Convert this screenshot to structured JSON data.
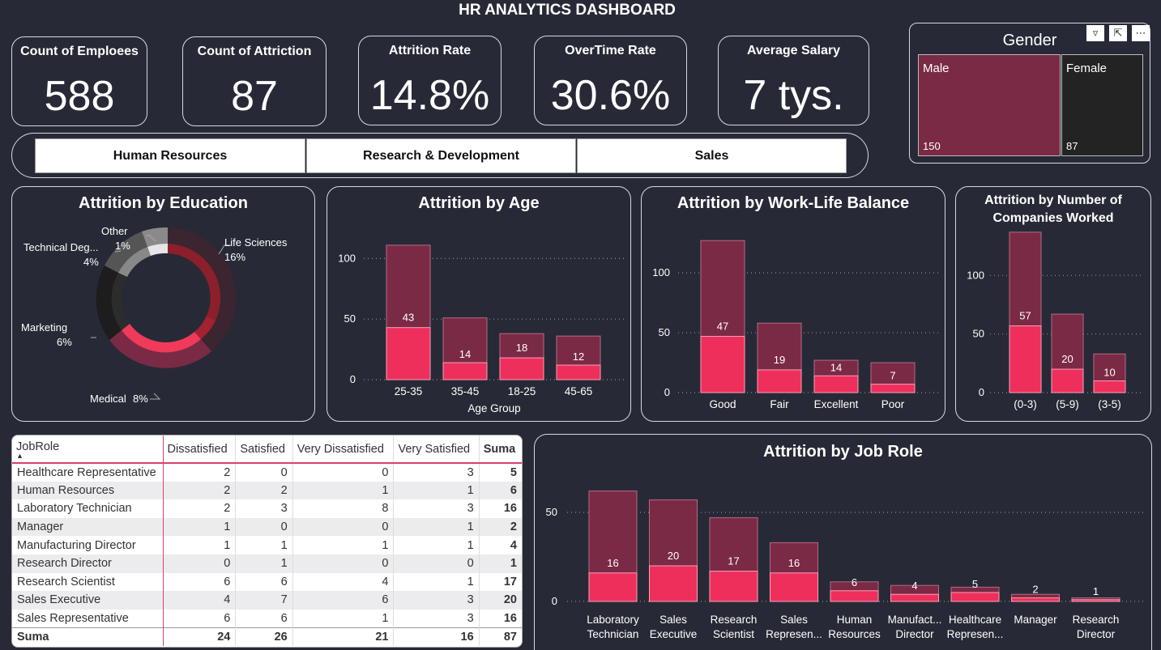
{
  "header": {
    "title": "HR ANALYTICS DASHBOARD"
  },
  "kpis": [
    {
      "label": "Count of Emploees",
      "value": "588"
    },
    {
      "label": "Count of Attriction",
      "value": "87"
    },
    {
      "label": "Attrition Rate",
      "value": "14.8%"
    },
    {
      "label": "OverTime Rate",
      "value": "30.6%"
    },
    {
      "label": "Average Salary",
      "value": "7 tys."
    }
  ],
  "departments": [
    "Human Resources",
    "Research & Development",
    "Sales"
  ],
  "gender": {
    "title": "Gender",
    "items": [
      {
        "label": "Male",
        "value": 150,
        "color": "#7a2a45"
      },
      {
        "label": "Female",
        "value": 87,
        "color": "#232323"
      }
    ]
  },
  "colors": {
    "bar_total": "#7a2a45",
    "bar_attr": "#ee2f5c",
    "accent": "#d7426d"
  },
  "chart_data": [
    {
      "id": "education",
      "type": "pie",
      "title": "Attrition by Education",
      "slices": [
        {
          "label": "Life Sciences",
          "pct": "16%",
          "color": "#8b1f2b"
        },
        {
          "label": "Medical",
          "pct": "8%",
          "color": "#f03a5a"
        },
        {
          "label": "Marketing",
          "pct": "6%",
          "color": "#1d1d1d"
        },
        {
          "label": "Technical Deg...",
          "pct": "4%",
          "color": "#6e6e6e"
        },
        {
          "label": "Other",
          "pct": "1%",
          "color": "#cfcfcf"
        }
      ]
    },
    {
      "id": "age",
      "type": "bar",
      "title": "Attrition by Age",
      "xlabel": "Age Group",
      "categories": [
        "25-35",
        "35-45",
        "18-25",
        "45-65"
      ],
      "series": [
        {
          "values": [
            111,
            51,
            38,
            36
          ]
        },
        {
          "values": [
            43,
            14,
            18,
            12
          ]
        }
      ],
      "yticks": [
        0,
        50,
        100
      ],
      "ylim": [
        0,
        125
      ]
    },
    {
      "id": "worklife",
      "type": "bar",
      "title": "Attrition by Work-Life Balance",
      "categories": [
        "Good",
        "Fair",
        "Excellent",
        "Poor"
      ],
      "series": [
        {
          "values": [
            127,
            58,
            27,
            25
          ]
        },
        {
          "values": [
            47,
            19,
            14,
            7
          ]
        }
      ],
      "yticks": [
        0,
        50,
        100
      ],
      "ylim": [
        0,
        140
      ]
    },
    {
      "id": "companies",
      "type": "bar",
      "title": "Attrition by Number of Companies Worked",
      "categories": [
        "(0-3)",
        "(5-9)",
        "(3-5)"
      ],
      "series": [
        {
          "values": [
            137,
            67,
            33
          ]
        },
        {
          "values": [
            57,
            20,
            10
          ]
        }
      ],
      "yticks": [
        0,
        50,
        100
      ],
      "ylim": [
        0,
        150
      ]
    },
    {
      "id": "jobrole",
      "type": "bar",
      "title": "Attrition by Job Role",
      "categories": [
        [
          "Laboratory",
          "Technician"
        ],
        [
          "Sales",
          "Executive"
        ],
        [
          "Research",
          "Scientist"
        ],
        [
          "Sales",
          "Represen..."
        ],
        [
          "Human",
          "Resources"
        ],
        [
          "Manufact...",
          "Director"
        ],
        [
          "Healthcare",
          "Represen..."
        ],
        [
          "Manager",
          ""
        ],
        [
          "Research",
          "Director"
        ]
      ],
      "series": [
        {
          "values": [
            62,
            57,
            47,
            33,
            11,
            9,
            8,
            4,
            2
          ]
        },
        {
          "values": [
            16,
            20,
            17,
            16,
            6,
            4,
            5,
            2,
            1
          ]
        }
      ],
      "yticks": [
        0,
        50
      ],
      "ylim": [
        0,
        70
      ]
    },
    {
      "id": "satisfaction_table",
      "type": "table",
      "columns": [
        "JobRole",
        "Dissatisfied",
        "Satisfied",
        "Very Dissatisfied",
        "Very Satisfied",
        "Suma"
      ],
      "rows": [
        [
          "Healthcare Representative",
          "2",
          "0",
          "0",
          "3",
          "5"
        ],
        [
          "Human Resources",
          "2",
          "2",
          "1",
          "1",
          "6"
        ],
        [
          "Laboratory Technician",
          "2",
          "3",
          "8",
          "3",
          "16"
        ],
        [
          "Manager",
          "1",
          "0",
          "0",
          "1",
          "2"
        ],
        [
          "Manufacturing Director",
          "1",
          "1",
          "1",
          "1",
          "4"
        ],
        [
          "Research Director",
          "0",
          "1",
          "0",
          "0",
          "1"
        ],
        [
          "Research Scientist",
          "6",
          "6",
          "4",
          "1",
          "17"
        ],
        [
          "Sales Executive",
          "4",
          "7",
          "6",
          "3",
          "20"
        ],
        [
          "Sales Representative",
          "6",
          "6",
          "1",
          "3",
          "16"
        ]
      ],
      "total": [
        "Suma",
        "24",
        "26",
        "21",
        "16",
        "87"
      ]
    }
  ]
}
